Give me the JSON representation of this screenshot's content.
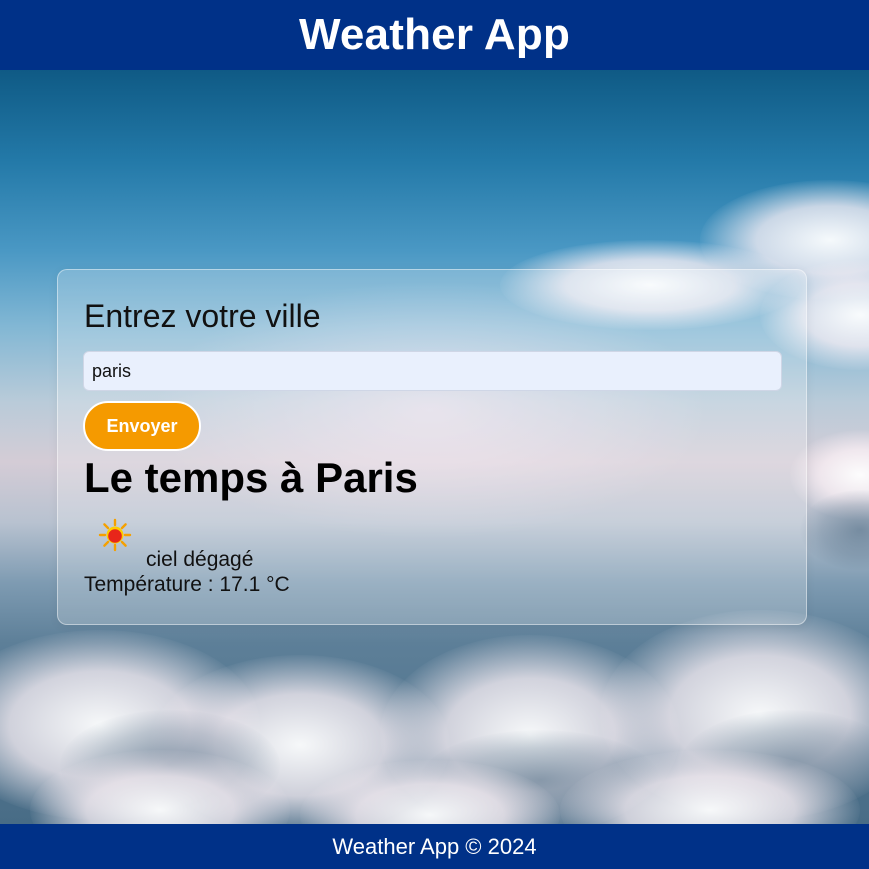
{
  "header": {
    "title": "Weather App"
  },
  "form": {
    "heading": "Entrez votre ville",
    "city_input_value": "paris",
    "submit_label": "Envoyer"
  },
  "result": {
    "title": "Le temps à Paris",
    "icon": "sun-icon",
    "description": "ciel dégagé",
    "temperature_text": "Température : 17.1 °C"
  },
  "footer": {
    "text": "Weather App © 2024"
  },
  "colors": {
    "header_bg": "#003188",
    "footer_bg": "#003188",
    "button_bg": "#f59a00",
    "input_bg": "#e9f0fd"
  }
}
